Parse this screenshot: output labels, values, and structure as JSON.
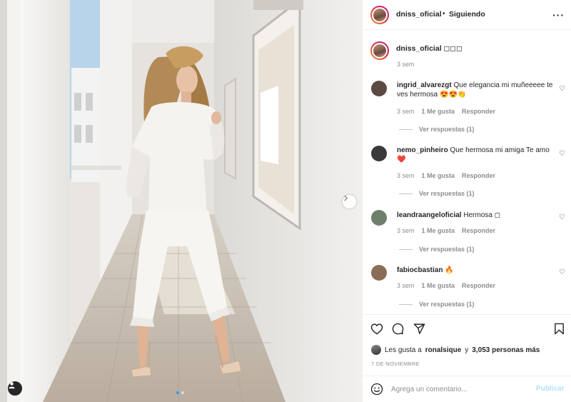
{
  "post": {
    "username": "dniss_oficial",
    "separator": "•",
    "follow_label": "Siguiendo",
    "more_label": "···",
    "caption_text": "◻◻◻",
    "caption_time": "3 sem"
  },
  "carousel": {
    "dots": 2,
    "active": 1
  },
  "comments": [
    {
      "username": "ingrid_alvarezgt",
      "text": "Que elegancia mi muñeeeee te ves hermosa 😍😍👏",
      "time": "3 sem",
      "likes": "1 Me gusta",
      "reply": "Responder",
      "replies": "Ver respuestas (1)",
      "avatar_color": "#5b4a44"
    },
    {
      "username": "nemo_pinheiro",
      "text": "Que hermosa mi amiga Te amo ❤️",
      "time": "3 sem",
      "likes": "1 Me gusta",
      "reply": "Responder",
      "replies": "Ver respuestas (1)",
      "avatar_color": "#3a3a3a"
    },
    {
      "username": "leandraangeloficial",
      "text": "Hermosa ◻",
      "time": "3 sem",
      "likes": "1 Me gusta",
      "reply": "Responder",
      "replies": "Ver respuestas (1)",
      "avatar_color": "#6e7f6a"
    },
    {
      "username": "fabiocbastian",
      "text": "🔥",
      "time": "3 sem",
      "likes": "1 Me gusta",
      "reply": "Responder",
      "replies": "Ver respuestas (1)",
      "avatar_color": "#8a6d55"
    }
  ],
  "likes": {
    "prefix": "Les gusta a",
    "user": "ronalsique",
    "conj": "y",
    "count": "3,053 personas más"
  },
  "date": "7 DE NOVIEMBRE",
  "add_comment": {
    "placeholder": "Agrega un comentario...",
    "publish_label": "Publicar"
  },
  "icons": {
    "like": "heart-icon",
    "comment": "comment-icon",
    "share": "share-icon",
    "save": "bookmark-icon",
    "emoji": "emoji-icon",
    "tag": "user-tag-icon",
    "next": "chevron-right-icon"
  },
  "colors": {
    "link": "#262626",
    "muted": "#8e8e8e",
    "publish_disabled": "#b2dffc",
    "active_dot": "#3897f0"
  }
}
